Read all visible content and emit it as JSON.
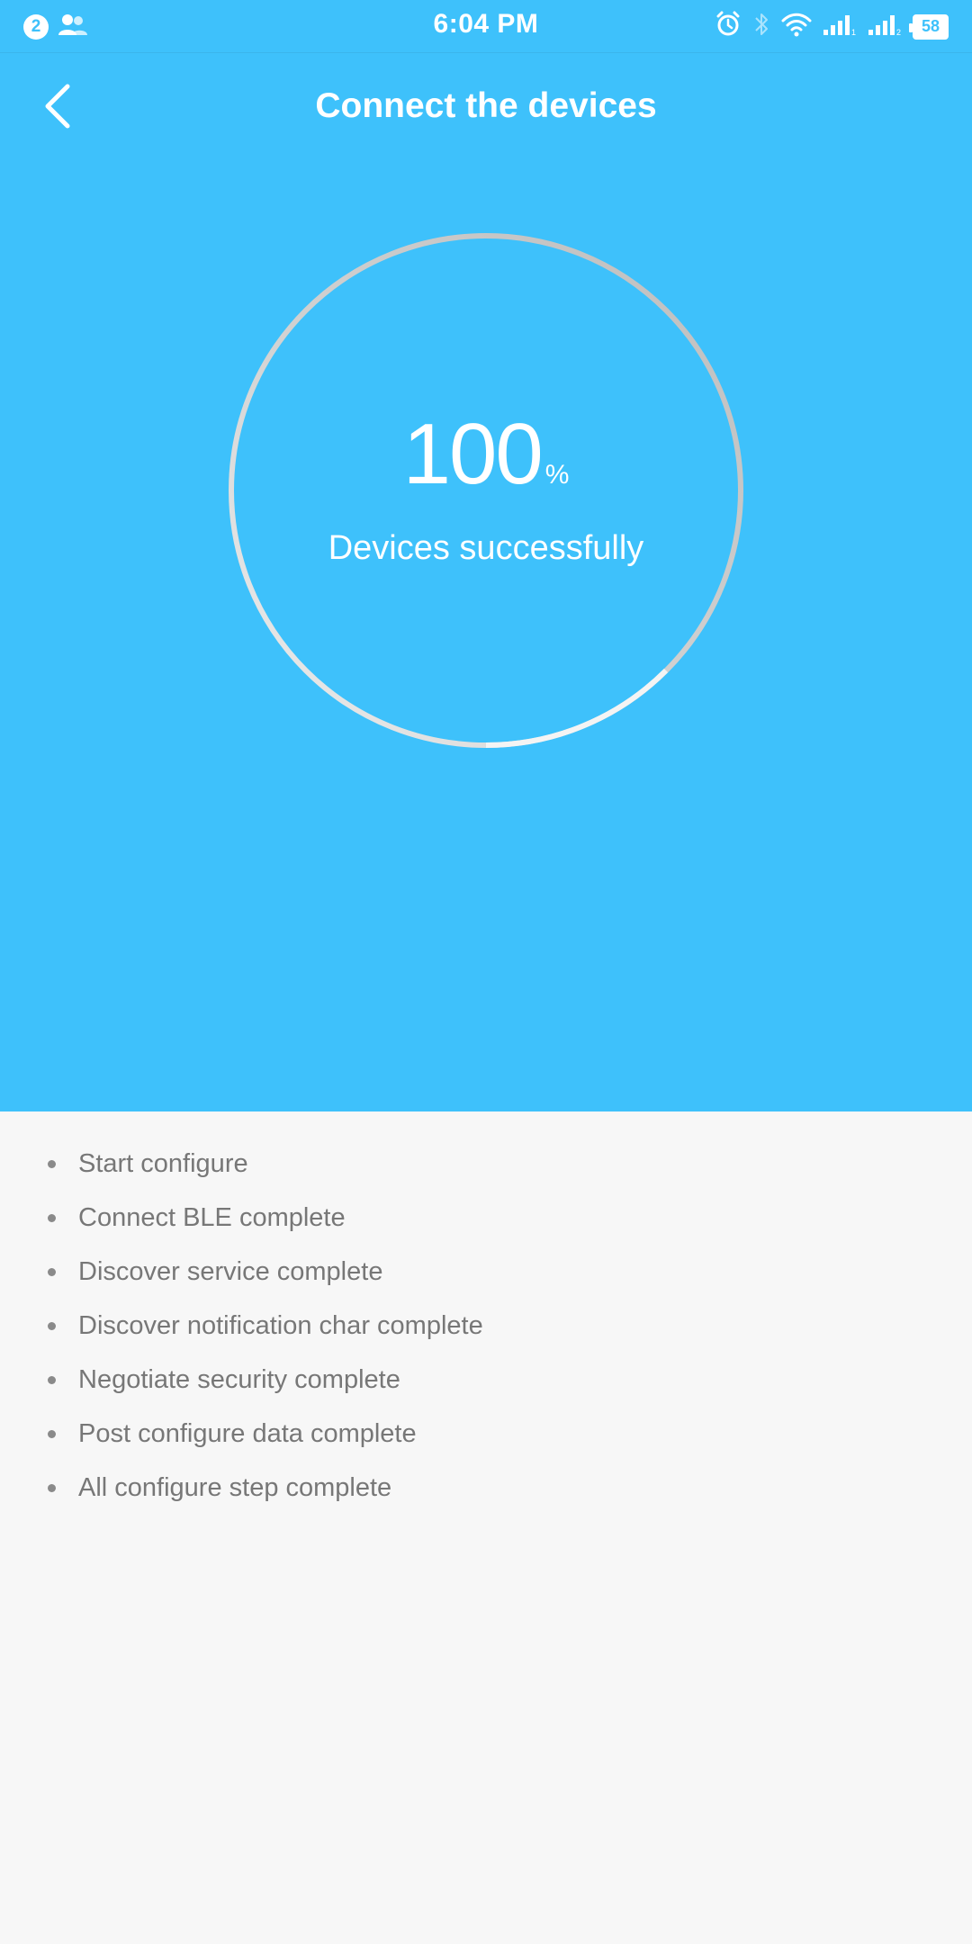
{
  "status_bar": {
    "notification_count": "2",
    "time": "6:04 PM",
    "battery": "58",
    "icons": [
      "notification-badge",
      "contacts-icon",
      "alarm-icon",
      "bluetooth-icon",
      "wifi-icon",
      "signal-1-icon",
      "signal-2-icon",
      "battery-icon"
    ]
  },
  "header": {
    "title": "Connect the devices",
    "back_icon": "chevron-left-icon"
  },
  "progress": {
    "value": "100",
    "unit": "%",
    "fraction": 1.0,
    "label": "Devices successfully"
  },
  "steps": [
    "Start configure",
    "Connect BLE complete",
    "Discover service complete",
    "Discover notification char complete",
    "Negotiate security complete",
    "Post configure data complete",
    "All configure step complete"
  ],
  "colors": {
    "accent": "#3ec1fb",
    "background": "#f7f7f7",
    "step_text": "#777777",
    "ring_track": "#bdbdbd",
    "ring_highlight": "#f2f2f2"
  }
}
